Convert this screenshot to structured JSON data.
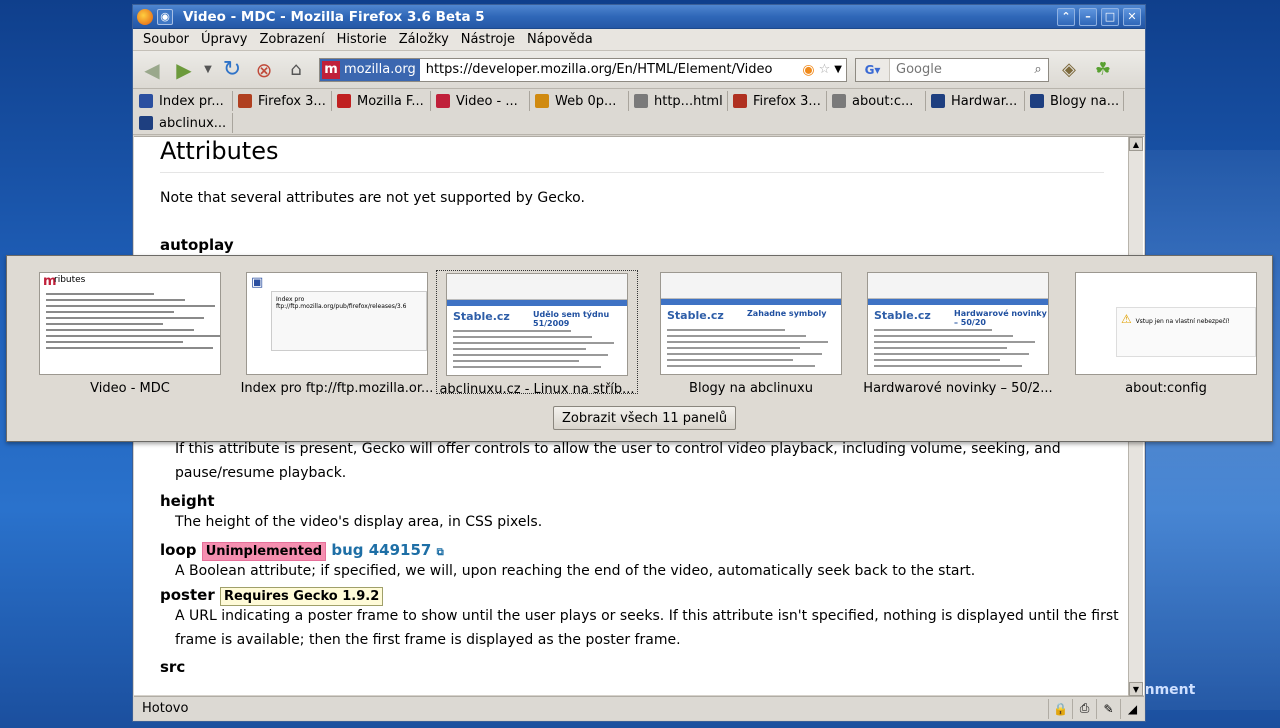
{
  "window": {
    "title": "Video - MDC - Mozilla Firefox 3.6 Beta 5"
  },
  "menubar": {
    "items": [
      {
        "label": "Soubor"
      },
      {
        "label": "Úpravy"
      },
      {
        "label": "Zobrazení"
      },
      {
        "label": "Historie"
      },
      {
        "label": "Záložky"
      },
      {
        "label": "Nástroje"
      },
      {
        "label": "Nápověda"
      }
    ]
  },
  "navbar": {
    "site_identity": "mozilla.org",
    "url": "https://developer.mozilla.org/En/HTML/Element/Video",
    "search_placeholder": "Google"
  },
  "bookmarks": [
    {
      "label": "Index pr...",
      "icon": "monitor-icon",
      "color": "#2b4fa0"
    },
    {
      "label": "Firefox 3...",
      "icon": "robot-icon",
      "color": "#b04020"
    },
    {
      "label": "Mozilla F...",
      "icon": "dino-icon",
      "color": "#c02020"
    },
    {
      "label": "Video - ...",
      "icon": "mdc-icon",
      "color": "#c0203a"
    },
    {
      "label": "Web 0p...",
      "icon": "star-icon",
      "color": "#d08a10"
    },
    {
      "label": "http...html",
      "icon": "page-icon",
      "color": "#7a7a7a"
    },
    {
      "label": "Firefox 3...",
      "icon": "car-icon",
      "color": "#b03020"
    },
    {
      "label": "about:c...",
      "icon": "page-icon",
      "color": "#7a7a7a"
    },
    {
      "label": "Hardwar...",
      "icon": "penguin-icon",
      "color": "#1e3f80"
    },
    {
      "label": "Blogy na...",
      "icon": "penguin-icon",
      "color": "#1e3f80"
    },
    {
      "label": "abclinux...",
      "icon": "penguin-icon",
      "color": "#1e3f80"
    }
  ],
  "page": {
    "heading": "Attributes",
    "note": "Note that several attributes are not yet supported by Gecko.",
    "attrs": {
      "autoplay": {
        "name": "autoplay"
      },
      "controls_desc_1": "If this attribute is present, Gecko will offer controls to allow the user to control video playback, including volume, seeking, and",
      "controls_desc_2": "pause/resume playback.",
      "height": {
        "name": "height",
        "desc": "The height of the video's display area, in CSS pixels."
      },
      "loop": {
        "name": "loop",
        "badge": "Unimplemented",
        "bug": "bug 449157",
        "desc": "A Boolean attribute; if specified, we will, upon reaching the end of the video, automatically seek back to the start."
      },
      "poster": {
        "name": "poster",
        "badge": "Requires Gecko 1.9.2",
        "desc_1": "A URL indicating a poster frame to show until the user plays or seeks. If this attribute isn't specified, nothing is displayed until the first",
        "desc_2": "frame is available; then the first frame is displayed as the poster frame."
      },
      "src": {
        "name": "src"
      }
    }
  },
  "tab_previews": {
    "tabs": [
      {
        "label": "Video - MDC",
        "kind": "mdc",
        "thumb_title": "ributes",
        "selected": false
      },
      {
        "label": "Index pro ftp://ftp.mozilla.or...",
        "kind": "ftp",
        "thumb_title": "Index pro ftp://ftp.mozilla.org/pub/firefox/releases/3.6",
        "selected": false
      },
      {
        "label": "abclinuxu.cz - Linux na stříb...",
        "kind": "abc",
        "thumb_title": "Udělo sem týdnu 51/2009",
        "selected": true
      },
      {
        "label": "Blogy na abclinuxu",
        "kind": "abc",
        "thumb_title": "Zahadne symboly",
        "selected": false
      },
      {
        "label": "Hardwarové novinky – 50/2...",
        "kind": "abc",
        "thumb_title": "Hardwarové novinky – 50/20",
        "selected": false
      },
      {
        "label": "about:config",
        "kind": "config",
        "thumb_title": "Vstup jen na vlastní nebezpečí!",
        "selected": false
      }
    ],
    "show_all_label": "Zobrazit všech 11 panelů",
    "thumb_brand": "Stable.cz"
  },
  "statusbar": {
    "text": "Hotovo"
  },
  "desktop": {
    "text": "onment"
  }
}
